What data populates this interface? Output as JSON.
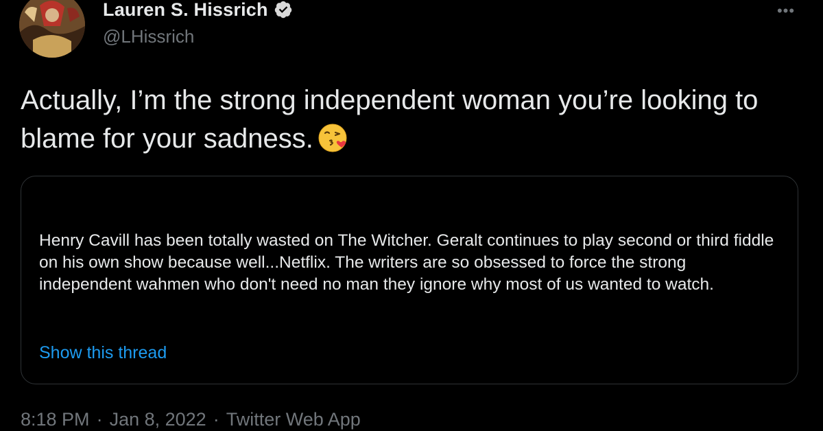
{
  "author": {
    "display_name": "Lauren S. Hissrich",
    "handle": "@LHissrich",
    "verified": true,
    "avatar_icon": "profile-avatar"
  },
  "more_icon": "ellipsis-icon",
  "tweet": {
    "text": "Actually, I’m the strong independent woman you’re looking to blame for your sadness.",
    "emoji": "face-throwing-a-kiss-emoji"
  },
  "quoted_tweet": {
    "text": "Henry Cavill has been totally wasted on The Witcher. Geralt continues to play second or third fiddle on his own show because well...Netflix.  The writers are so obsessed to force the strong independent wahmen who don't need no man they ignore why most of us wanted to watch.",
    "show_thread_label": "Show this thread"
  },
  "meta": {
    "time": "8:18 PM",
    "separator": "·",
    "date": "Jan 8, 2022",
    "source": "Twitter Web App"
  },
  "colors": {
    "background": "#000000",
    "text_primary": "#e7e9ea",
    "text_secondary": "#71767b",
    "link": "#1d9bf0",
    "verified_badge": "#d9d9d9",
    "card_border": "#2f3336"
  }
}
